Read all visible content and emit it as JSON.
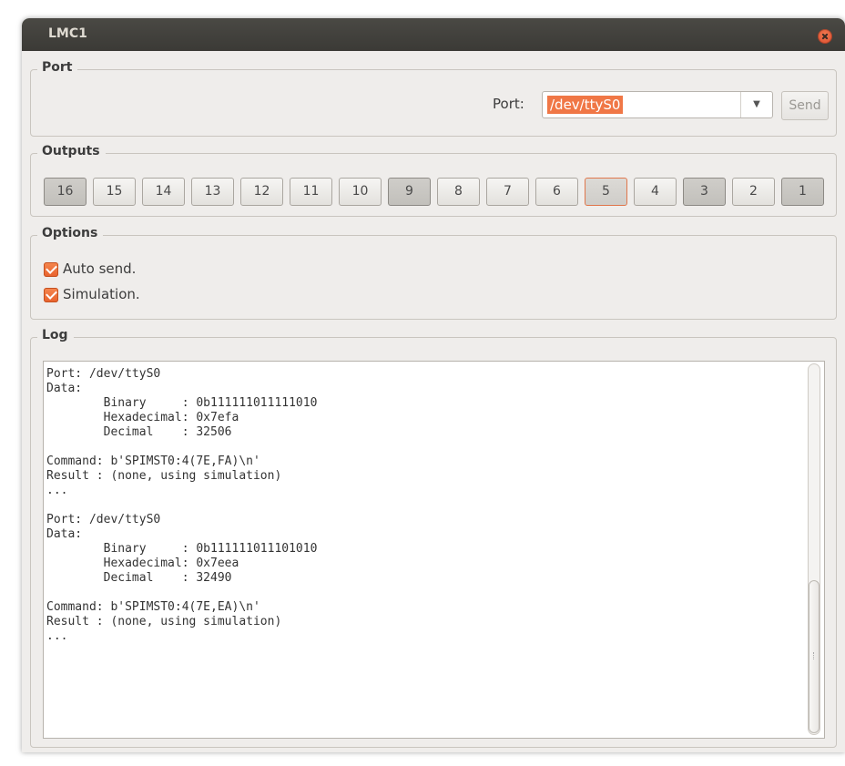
{
  "window": {
    "title": "LMC1"
  },
  "port_group": {
    "title": "Port",
    "port_label": "Port:",
    "port_value": "/dev/ttyS0",
    "send_label": "Send"
  },
  "outputs_group": {
    "title": "Outputs",
    "buttons": [
      {
        "label": "16",
        "active": true
      },
      {
        "label": "15",
        "active": false
      },
      {
        "label": "14",
        "active": false
      },
      {
        "label": "13",
        "active": false
      },
      {
        "label": "12",
        "active": false
      },
      {
        "label": "11",
        "active": false
      },
      {
        "label": "10",
        "active": false
      },
      {
        "label": "9",
        "active": true
      },
      {
        "label": "8",
        "active": false
      },
      {
        "label": "7",
        "active": false
      },
      {
        "label": "6",
        "active": false
      },
      {
        "label": "5",
        "active": true,
        "focused": true
      },
      {
        "label": "4",
        "active": false
      },
      {
        "label": "3",
        "active": true
      },
      {
        "label": "2",
        "active": false
      },
      {
        "label": "1",
        "active": true
      }
    ]
  },
  "options_group": {
    "title": "Options",
    "auto_send": {
      "label": "Auto send.",
      "checked": true
    },
    "simulation": {
      "label": "Simulation.",
      "checked": true
    }
  },
  "log_group": {
    "title": "Log",
    "text": "Port: /dev/ttyS0\nData:\n        Binary     : 0b111111011111010\n        Hexadecimal: 0x7efa\n        Decimal    : 32506\n\nCommand: b'SPIMST0:4(7E,FA)\\n'\nResult : (none, using simulation)\n...\n\nPort: /dev/ttyS0\nData:\n        Binary     : 0b111111011101010\n        Hexadecimal: 0x7eea\n        Decimal    : 32490\n\nCommand: b'SPIMST0:4(7E,EA)\\n'\nResult : (none, using simulation)\n..."
  },
  "colors": {
    "accent": "#f07746",
    "titlebar": "#3d3c38",
    "window_bg": "#efedeb"
  }
}
